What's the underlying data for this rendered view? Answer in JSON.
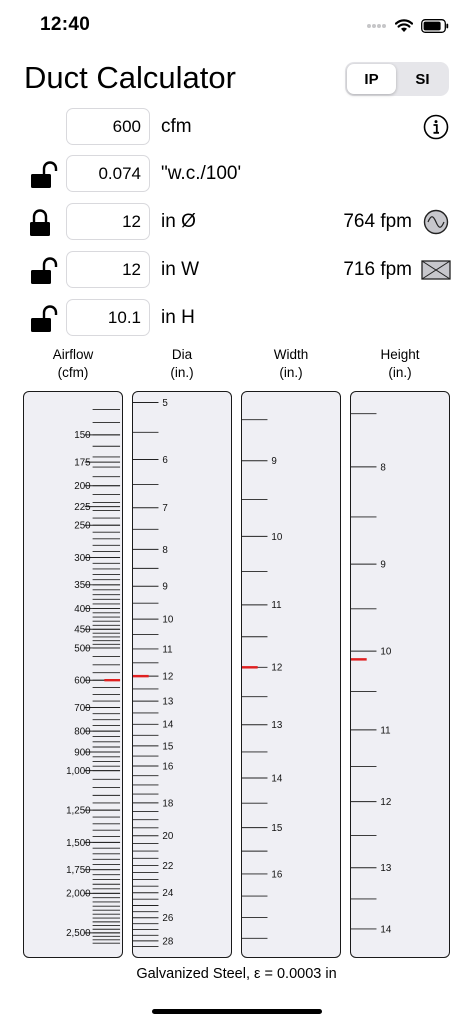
{
  "status": {
    "time": "12:40"
  },
  "header": {
    "title": "Duct Calculator",
    "units": {
      "options": [
        "IP",
        "SI"
      ],
      "selected": "IP"
    }
  },
  "inputs": {
    "airflow": {
      "value": "600",
      "unit": "cfm"
    },
    "friction": {
      "value": "0.074",
      "unit": "\"w.c./100'"
    },
    "diameter": {
      "value": "12",
      "unit": "in Ø",
      "velocity": "764 fpm"
    },
    "width": {
      "value": "12",
      "unit": "in W",
      "velocity": "716 fpm"
    },
    "height": {
      "value": "10.1",
      "unit": "in H"
    }
  },
  "scales": {
    "airflow": {
      "label_line1": "Airflow",
      "label_line2": "(cfm)",
      "min": 125,
      "max": 2700,
      "log": true,
      "labels": [
        "150",
        "175",
        "200",
        "225",
        "250",
        "300",
        "350",
        "400",
        "450",
        "500",
        "600",
        "700",
        "800",
        "900",
        "1,000",
        "1,250",
        "1,500",
        "1,750",
        "2,000",
        "2,500"
      ],
      "label_values": [
        150,
        175,
        200,
        225,
        250,
        300,
        350,
        400,
        450,
        500,
        600,
        700,
        800,
        900,
        1000,
        1250,
        1500,
        1750,
        2000,
        2500
      ],
      "current": 600
    },
    "diameter": {
      "label_line1": "Dia",
      "label_line2": "(in.)",
      "min": 5,
      "max": 28.5,
      "log": true,
      "labels": [
        "5",
        "6",
        "7",
        "8",
        "9",
        "10",
        "11",
        "12",
        "13",
        "14",
        "15",
        "16",
        "18",
        "20",
        "22",
        "24",
        "26",
        "28"
      ],
      "label_values": [
        5,
        6,
        7,
        8,
        9,
        10,
        11,
        12,
        13,
        14,
        15,
        16,
        18,
        20,
        22,
        24,
        26,
        28
      ],
      "current": 12
    },
    "width": {
      "label_line1": "Width",
      "label_line2": "(in.)",
      "min": 8.3,
      "max": 17.7,
      "log": true,
      "labels": [
        "9",
        "10",
        "11",
        "12",
        "13",
        "14",
        "15",
        "16"
      ],
      "label_values": [
        9,
        10,
        11,
        12,
        13,
        14,
        15,
        16
      ],
      "current": 12
    },
    "height": {
      "label_line1": "Height",
      "label_line2": "(in.)",
      "min": 7.4,
      "max": 14.3,
      "log": true,
      "labels": [
        "8",
        "9",
        "10",
        "11",
        "12",
        "13",
        "14"
      ],
      "label_values": [
        8,
        9,
        10,
        11,
        12,
        13,
        14
      ],
      "current": 10.1
    }
  },
  "footer": {
    "material": "Galvanized Steel, ε = 0.0003 in"
  },
  "colors": {
    "indicator": "#e02020",
    "ruler_bg": "#efeff4"
  }
}
